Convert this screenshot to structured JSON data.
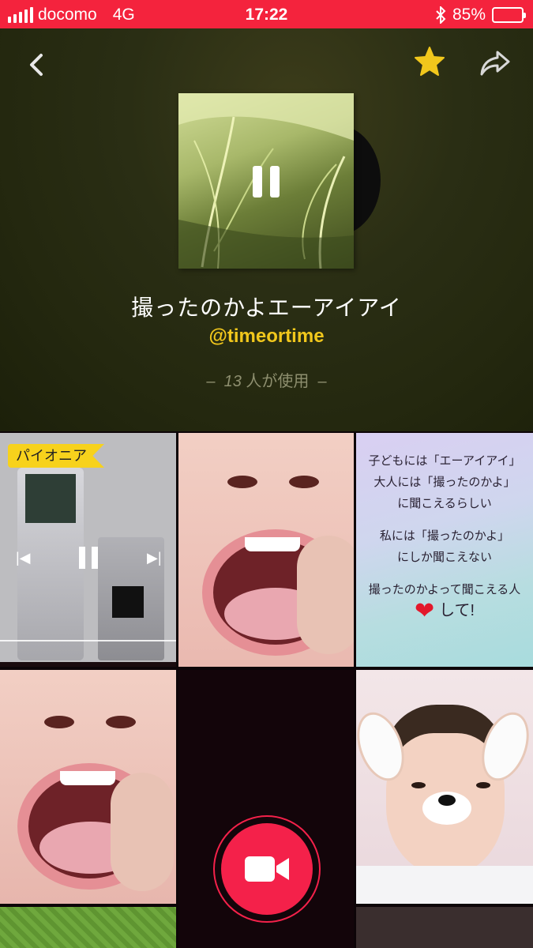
{
  "status_bar": {
    "carrier": "docomo",
    "network": "4G",
    "time": "17:22",
    "battery_percent": "85%",
    "battery_level": 0.85,
    "background_color": "#f4233d"
  },
  "header": {
    "back_icon": "chevron-left-icon",
    "favorite_icon": "star-icon",
    "favorite_color": "#f1c71c",
    "share_icon": "share-arrow-icon",
    "play_state_icon": "pause-icon"
  },
  "song": {
    "title": "撮ったのかよエーアイアイ",
    "author": "@timeortime",
    "usage_prefix": "–",
    "usage_count": "13",
    "usage_label": "人が使用",
    "usage_suffix": "–"
  },
  "grid": {
    "tile1": {
      "badge": "パイオニア",
      "badge_color": "#f7d21c",
      "prev_icon": "skip-previous-icon",
      "pause_icon": "pause-icon",
      "next_icon": "skip-next-icon"
    },
    "tile3": {
      "line1": "子どもには「エーアイアイ」",
      "line2": "大人には「撮ったのかよ」",
      "line3": "に聞こえるらしい",
      "line4": "私には「撮ったのかよ」",
      "line5": "にしか聞こえない",
      "line6": "撮ったのかよって聞こえる人",
      "line7": "して!",
      "heart_icon": "heart-icon"
    },
    "record": {
      "icon": "video-camera-icon",
      "color": "#f4214a"
    }
  }
}
